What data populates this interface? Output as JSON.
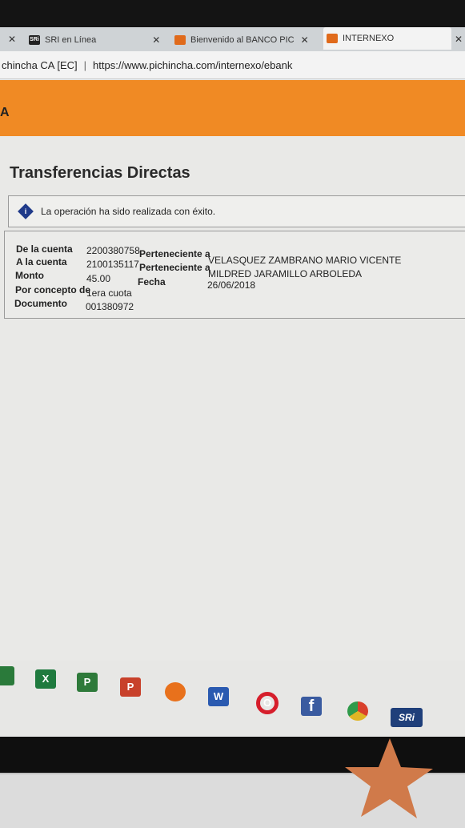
{
  "browser": {
    "tabs": [
      {
        "label": "SRI en Línea",
        "favicon_text": "SRi",
        "close": "x"
      },
      {
        "label": "Bienvenido al BANCO PIC",
        "close": "x"
      },
      {
        "label": "INTERNEXO",
        "close": "x"
      }
    ],
    "site_identity": "chincha CA [EC]",
    "url": "https://www.pichincha.com/internexo/ebank"
  },
  "header": {
    "logo_fragment": "A"
  },
  "page": {
    "title": "Transferencias Directas",
    "info_icon_glyph": "i",
    "message": "La operación ha sido realizada con éxito."
  },
  "details": {
    "from_label": "De la cuenta",
    "from_account": "2200380758",
    "from_owner_label": "Perteneciente a",
    "from_owner": "VELASQUEZ ZAMBRANO MARIO VICENTE",
    "to_label": "A la cuenta",
    "to_account": "2100135117",
    "to_owner_label": "Perteneciente a",
    "to_owner": "MILDRED JARAMILLO ARBOLEDA",
    "amount_label": "Monto",
    "amount": "45.00",
    "date_label": "Fecha",
    "date": "26/06/2018",
    "concept_label": "Por concepto de",
    "concept": "1era cuota",
    "document_label": "Documento",
    "document": "001380972"
  },
  "taskbar": {
    "apps": [
      {
        "name": "excel",
        "glyph": "X",
        "color": "#1f7a3e"
      },
      {
        "name": "project",
        "glyph": "P",
        "color": "#2e7a3a"
      },
      {
        "name": "powerpoint",
        "glyph": "P",
        "color": "#c8412b"
      },
      {
        "name": "firefox",
        "glyph": "",
        "color": "#e8711c"
      },
      {
        "name": "word",
        "glyph": "W",
        "color": "#2a5ab0"
      },
      {
        "name": "opera",
        "glyph": "O",
        "color": "#d61e2b"
      },
      {
        "name": "facebook",
        "glyph": "f",
        "color": "#3a5ba0"
      },
      {
        "name": "chrome",
        "glyph": "",
        "color": "#d9a224"
      },
      {
        "name": "sri",
        "glyph": "SRi",
        "color": "#1f3f7a"
      }
    ]
  }
}
